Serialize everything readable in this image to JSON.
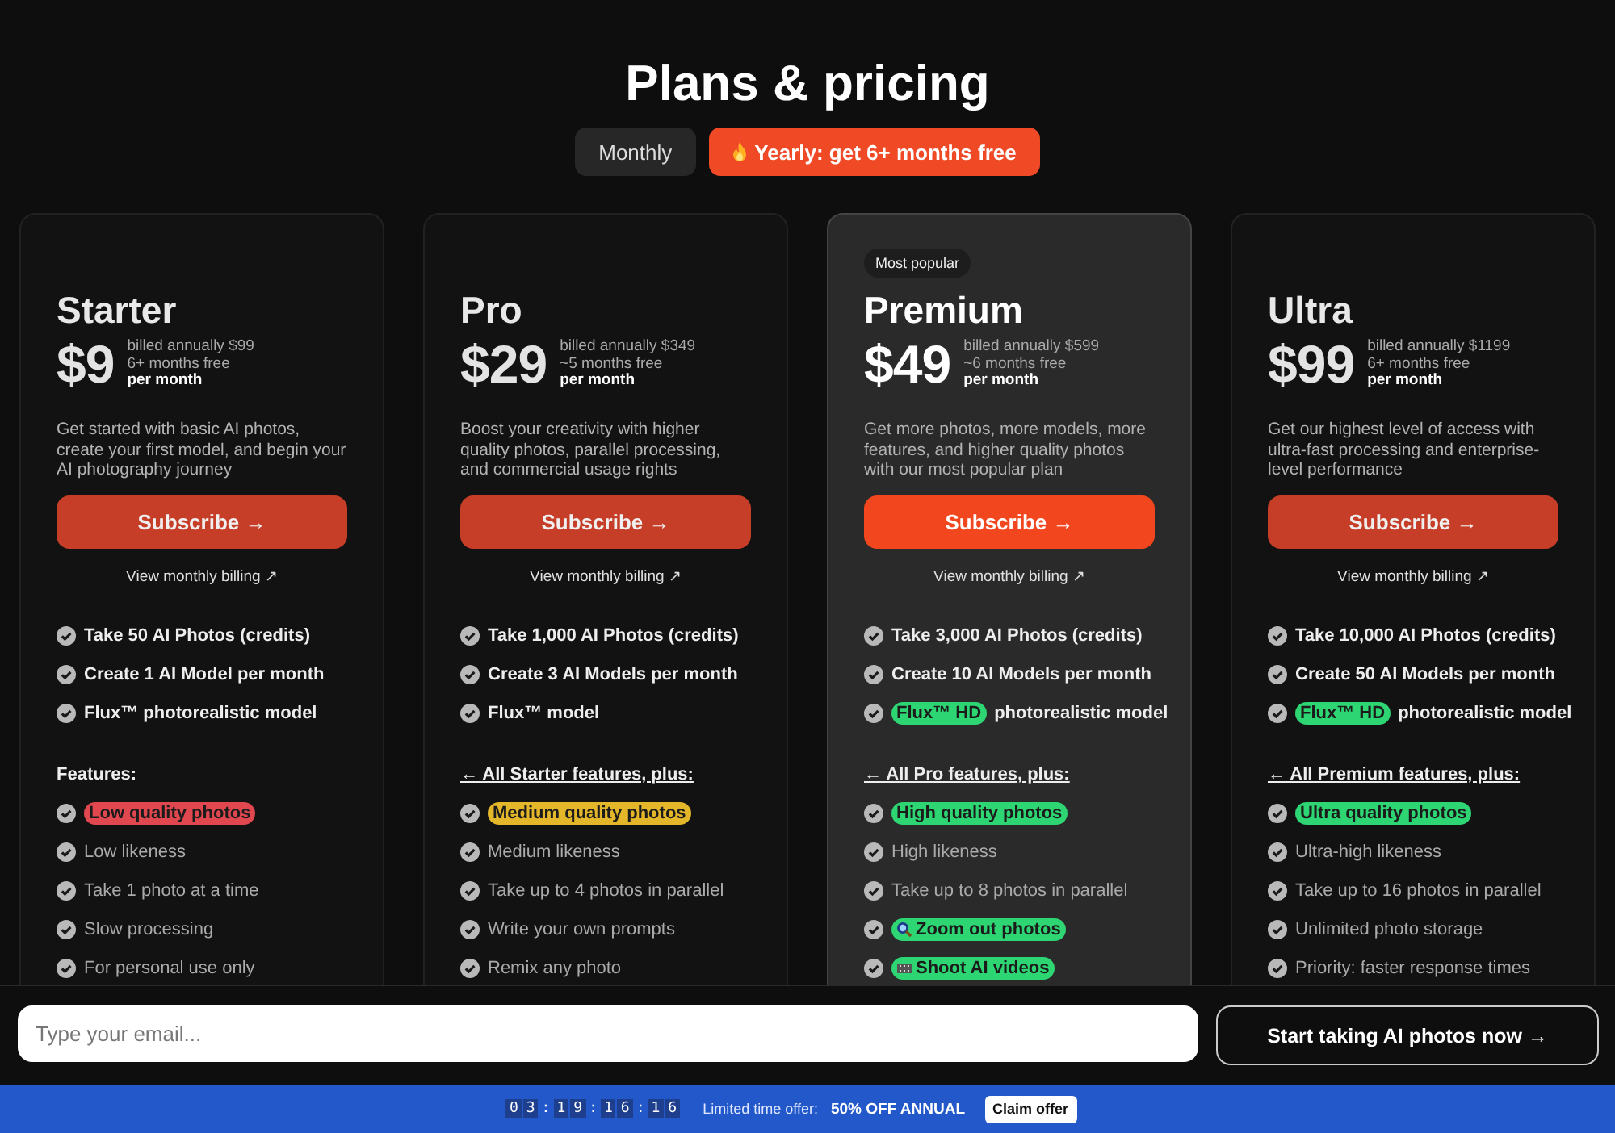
{
  "title": "Plans & pricing",
  "tabs": [
    {
      "label": "Monthly",
      "selected": false,
      "kind": "plain"
    },
    {
      "label": "Yearly: get 6+ months free",
      "selected": true,
      "kind": "promo"
    }
  ],
  "plans": [
    {
      "name": "Starter",
      "highlighted": false,
      "price": "$9",
      "billed": "billed annually $99",
      "free": "6+ months free",
      "per": "per month",
      "description": "Get started with basic AI photos, create your first model, and begin your AI photography journey",
      "button": "Subscribe →",
      "billing_link": "View monthly billing ↗",
      "includes": [
        {
          "kind": "plain",
          "text": "Take 50 AI Photos (credits)"
        },
        {
          "kind": "plain",
          "text": "Create 1 AI Model per month"
        },
        {
          "kind": "plain",
          "text": "Flux™ photorealistic model"
        }
      ],
      "features_heading": {
        "text": "Features:",
        "link": false
      },
      "features": [
        {
          "kind": "tag",
          "tag": {
            "text": "Low quality photos",
            "color": "#e0474f"
          }
        },
        {
          "kind": "plain",
          "text": "Low likeness"
        },
        {
          "kind": "plain",
          "text": "Take 1 photo at a time"
        },
        {
          "kind": "plain",
          "text": "Slow processing"
        },
        {
          "kind": "plain",
          "text": "For personal use only"
        }
      ]
    },
    {
      "name": "Pro",
      "highlighted": false,
      "price": "$29",
      "billed": "billed annually $349",
      "free": "~5 months free",
      "per": "per month",
      "description": "Boost your creativity with higher quality photos, parallel processing, and commercial usage rights",
      "button": "Subscribe →",
      "billing_link": "View monthly billing ↗",
      "includes": [
        {
          "kind": "plain",
          "text": "Take 1,000 AI Photos (credits)"
        },
        {
          "kind": "plain",
          "text": "Create 3 AI Models per month"
        },
        {
          "kind": "plain",
          "text": "Flux™ model"
        }
      ],
      "features_heading": {
        "text": "← All Starter features, plus:",
        "link": true
      },
      "features": [
        {
          "kind": "tag",
          "tag": {
            "text": "Medium quality photos",
            "color": "#e3b729"
          }
        },
        {
          "kind": "plain",
          "text": "Medium likeness"
        },
        {
          "kind": "plain",
          "text": "Take up to 4 photos in parallel"
        },
        {
          "kind": "plain",
          "text": "Write your own prompts"
        },
        {
          "kind": "plain",
          "text": "Remix any photo"
        }
      ]
    },
    {
      "name": "Premium",
      "highlighted": true,
      "badge": "Most popular",
      "price": "$49",
      "billed": "billed annually $599",
      "free": "~6 months free",
      "per": "per month",
      "description": "Get more photos, more models, more features, and higher quality photos with our most popular plan",
      "button": "Subscribe →",
      "billing_link": "View monthly billing ↗",
      "includes": [
        {
          "kind": "plain",
          "text": "Take 3,000 AI Photos (credits)"
        },
        {
          "kind": "plain",
          "text": "Create 10 AI Models per month"
        },
        {
          "kind": "tag",
          "tag": {
            "text": "Flux™ HD",
            "color": "#2ed573"
          },
          "text": "photorealistic model"
        }
      ],
      "features_heading": {
        "text": "← All Pro features, plus:",
        "link": true
      },
      "features": [
        {
          "kind": "tag",
          "tag": {
            "text": "High quality photos",
            "color": "#2ed573"
          }
        },
        {
          "kind": "plain",
          "text": "High likeness"
        },
        {
          "kind": "plain",
          "text": "Take up to 8 photos in parallel"
        },
        {
          "kind": "search",
          "tag": {
            "text": "Zoom out photos",
            "color": "#2ed573"
          }
        },
        {
          "kind": "video",
          "tag": {
            "text": "Shoot AI videos",
            "color": "#2ed573"
          }
        }
      ]
    },
    {
      "name": "Ultra",
      "highlighted": false,
      "price": "$99",
      "billed": "billed annually $1199",
      "free": "6+ months free",
      "per": "per month",
      "description": "Get our highest level of access with ultra-fast processing and enterprise-level performance",
      "button": "Subscribe →",
      "billing_link": "View monthly billing ↗",
      "includes": [
        {
          "kind": "plain",
          "text": "Take 10,000 AI Photos (credits)"
        },
        {
          "kind": "plain",
          "text": "Create 50 AI Models per month"
        },
        {
          "kind": "tag",
          "tag": {
            "text": "Flux™ HD",
            "color": "#2ed573"
          },
          "text": "photorealistic model"
        }
      ],
      "features_heading": {
        "text": "← All Premium features, plus:",
        "link": true
      },
      "features": [
        {
          "kind": "tag",
          "tag": {
            "text": "Ultra quality photos",
            "color": "#2ed573"
          }
        },
        {
          "kind": "plain",
          "text": "Ultra-high likeness"
        },
        {
          "kind": "plain",
          "text": "Take up to 16 photos in parallel"
        },
        {
          "kind": "plain",
          "text": "Unlimited photo storage"
        },
        {
          "kind": "plain",
          "text": "Priority: faster response times"
        }
      ]
    }
  ],
  "signup": {
    "placeholder": "Type your email...",
    "button": "Start taking AI photos now →"
  },
  "offer_bar": {
    "countdown": [
      "0",
      "3",
      ":",
      "1",
      "9",
      ":",
      "1",
      "6",
      ":",
      "1",
      "6"
    ],
    "label": "Limited time offer:",
    "deal": "50% OFF ANNUAL",
    "button": "Claim offer"
  }
}
